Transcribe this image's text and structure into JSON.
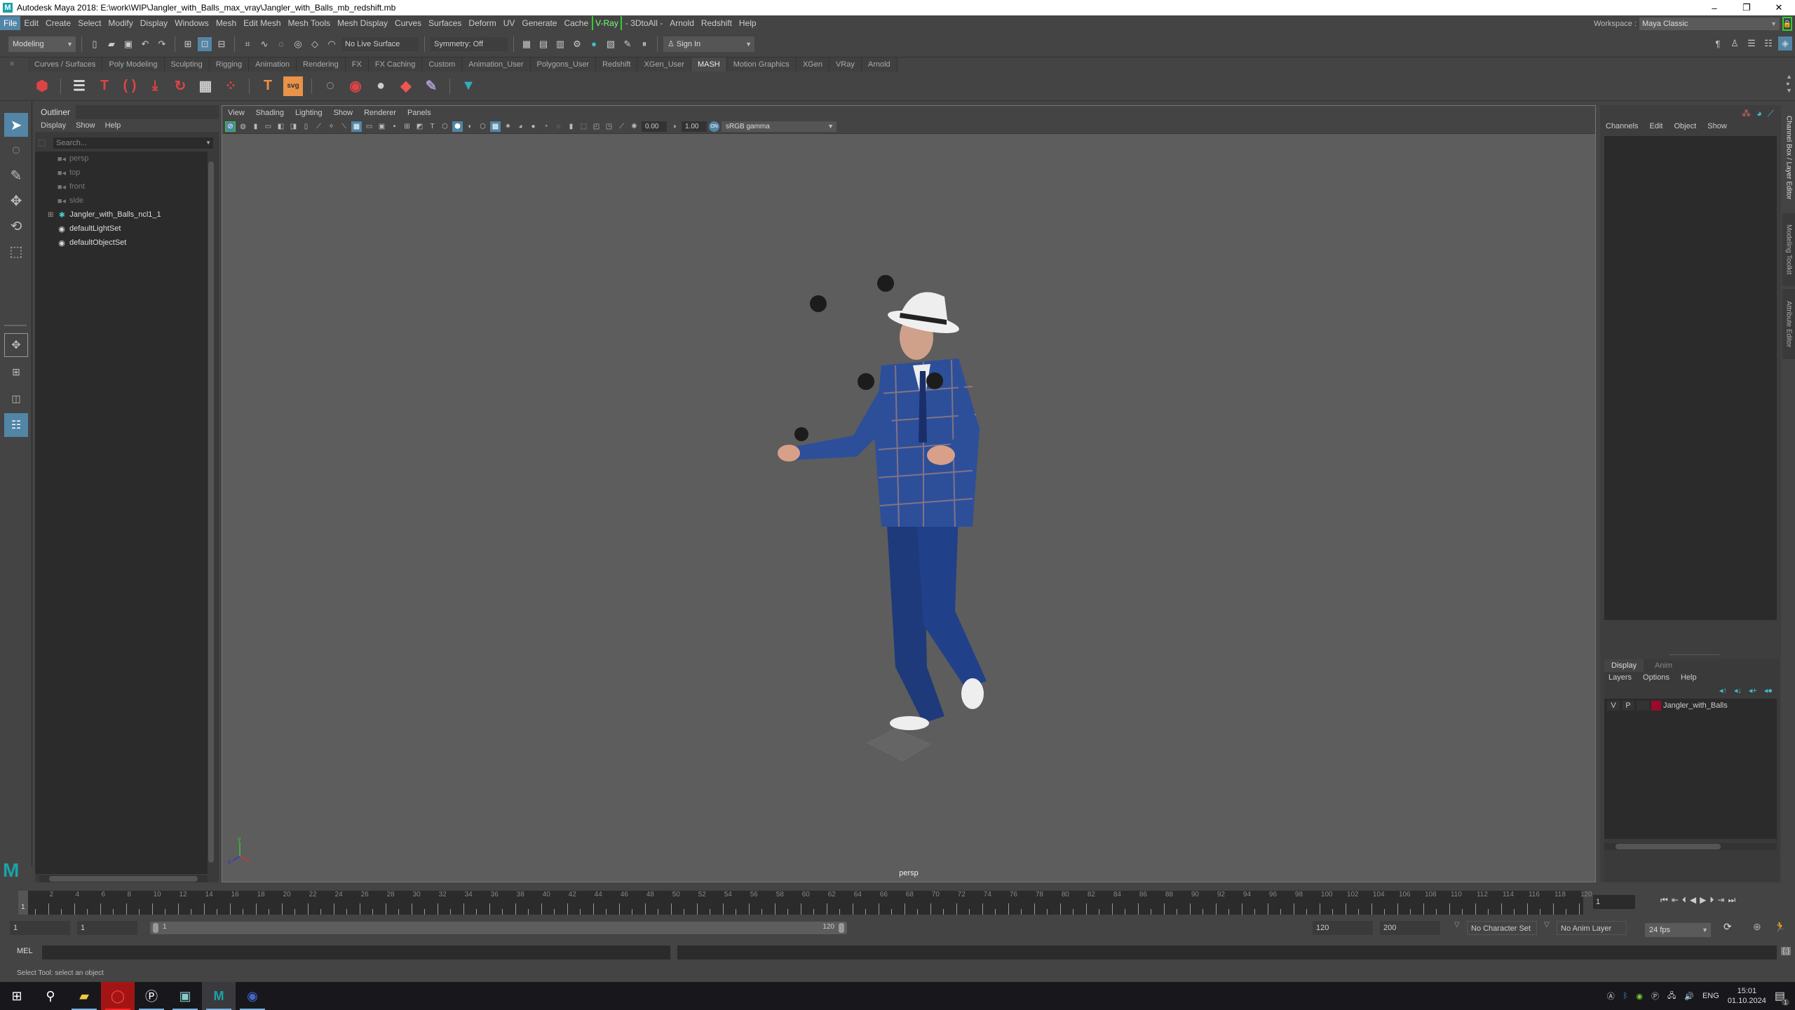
{
  "window": {
    "title": "Autodesk Maya 2018: E:\\work\\WIP\\Jangler_with_Balls_max_vray\\Jangler_with_Balls_mb_redshift.mb",
    "minimize": "–",
    "maximize": "❐",
    "close": "✕"
  },
  "menubar": [
    "File",
    "Edit",
    "Create",
    "Select",
    "Modify",
    "Display",
    "Windows",
    "Mesh",
    "Edit Mesh",
    "Mesh Tools",
    "Mesh Display",
    "Curves",
    "Surfaces",
    "Deform",
    "UV",
    "Generate",
    "Cache",
    "V-Ray",
    "- 3DtoAll -",
    "Arnold",
    "Redshift",
    "Help"
  ],
  "workspace": {
    "label": "Workspace :",
    "value": "Maya Classic"
  },
  "statusline": {
    "mode": "Modeling",
    "live_surface": "No Live Surface",
    "symmetry": "Symmetry: Off",
    "sign_in": "Sign In"
  },
  "shelf_tabs": [
    "Curves / Surfaces",
    "Poly Modeling",
    "Sculpting",
    "Rigging",
    "Animation",
    "Rendering",
    "FX",
    "FX Caching",
    "Custom",
    "Animation_User",
    "Polygons_User",
    "Redshift",
    "XGen_User",
    "MASH",
    "Motion Graphics",
    "XGen",
    "VRay",
    "Arnold"
  ],
  "shelf_active": "MASH",
  "outliner": {
    "title": "Outliner",
    "menu": [
      "Display",
      "Show",
      "Help"
    ],
    "search_placeholder": "Search...",
    "items": [
      {
        "label": "persp",
        "icon": "camera-icon",
        "dim": true
      },
      {
        "label": "top",
        "icon": "camera-icon",
        "dim": true
      },
      {
        "label": "front",
        "icon": "camera-icon",
        "dim": true
      },
      {
        "label": "side",
        "icon": "camera-icon",
        "dim": true
      },
      {
        "label": "Jangler_with_Balls_ncl1_1",
        "icon": "joint-icon",
        "dim": false,
        "expandable": true
      },
      {
        "label": "defaultLightSet",
        "icon": "set-icon",
        "dim": false
      },
      {
        "label": "defaultObjectSet",
        "icon": "set-icon",
        "dim": false
      }
    ]
  },
  "viewport": {
    "menu": [
      "View",
      "Shading",
      "Lighting",
      "Show",
      "Renderer",
      "Panels"
    ],
    "exposure": "0.00",
    "gamma": "1.00",
    "color_space": "sRGB gamma",
    "camera": "persp"
  },
  "channel_box": {
    "menu": [
      "Channels",
      "Edit",
      "Object",
      "Show"
    ]
  },
  "layer_editor": {
    "tabs": [
      "Display",
      "Anim"
    ],
    "menu": [
      "Layers",
      "Options",
      "Help"
    ],
    "layers": [
      {
        "v": "V",
        "p": "P",
        "color": "#9b0a2a",
        "name": "Jangler_with_Balls"
      }
    ]
  },
  "side_tabs": [
    "Channel Box / Layer Editor",
    "Modeling Toolkit",
    "Attribute Editor"
  ],
  "timeslider": {
    "ticks": [
      "2",
      "4",
      "6",
      "8",
      "10",
      "12",
      "14",
      "16",
      "18",
      "20",
      "22",
      "24",
      "26",
      "28",
      "30",
      "32",
      "34",
      "36",
      "38",
      "40",
      "42",
      "44",
      "46",
      "48",
      "50",
      "52",
      "54",
      "56",
      "58",
      "60",
      "62",
      "64",
      "66",
      "68",
      "70",
      "72",
      "74",
      "76",
      "78",
      "80",
      "82",
      "84",
      "86",
      "88",
      "90",
      "92",
      "94",
      "96",
      "98",
      "100",
      "102",
      "104",
      "106",
      "108",
      "110",
      "112",
      "114",
      "116",
      "118",
      "120"
    ],
    "current_marker": "1",
    "current_frame": "1"
  },
  "range": {
    "start": "1",
    "playback_start": "1",
    "slider_start": "1",
    "slider_end": "120",
    "playback_end": "120",
    "end": "200",
    "character_set": "No Character Set",
    "anim_layer": "No Anim Layer",
    "fps": "24 fps"
  },
  "cmdline": {
    "label": "MEL"
  },
  "helpline": "Select Tool: select an object",
  "taskbar": {
    "lang": "ENG",
    "time": "15:01",
    "date": "01.10.2024",
    "notifications": "1"
  }
}
